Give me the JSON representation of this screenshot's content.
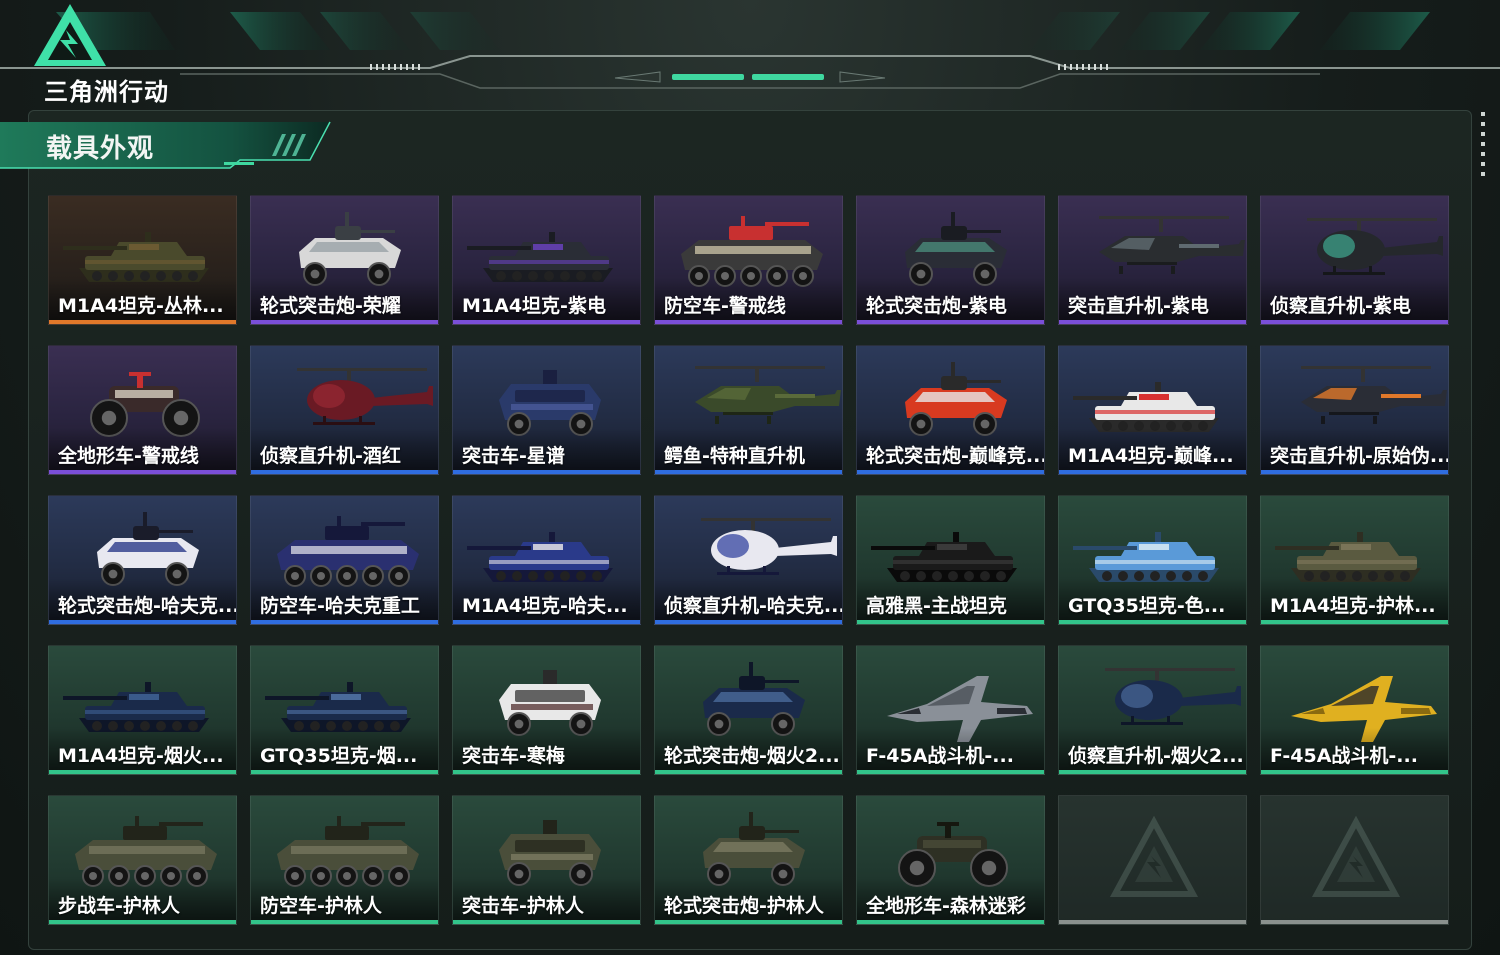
{
  "header": {
    "logo_text": "三角洲行动"
  },
  "section": {
    "title": "载具外观"
  },
  "colors": {
    "accent_green": "#32c48a",
    "rarity_orange": "#e0782a",
    "rarity_purple": "#7a4fd8",
    "rarity_blue": "#2f6de0",
    "rarity_green": "#32c48a",
    "empty": "#8a918e"
  },
  "items": [
    {
      "name": "M1A4坦克-丛林...",
      "rarity": "orange",
      "kind": "tank",
      "palette": [
        "#4a4a2c",
        "#6b5a32",
        "#2e2e1c"
      ]
    },
    {
      "name": "轮式突击炮-荣耀",
      "rarity": "purple",
      "kind": "armored-car",
      "palette": [
        "#d8d8d8",
        "#9aa3a8",
        "#3a3f44"
      ]
    },
    {
      "name": "M1A4坦克-紫电",
      "rarity": "purple",
      "kind": "tank",
      "palette": [
        "#2a2d36",
        "#5f3ea8",
        "#1a1c22"
      ]
    },
    {
      "name": "防空车-警戒线",
      "rarity": "purple",
      "kind": "apc",
      "palette": [
        "#3a3a3a",
        "#d8d0b0",
        "#c83030"
      ]
    },
    {
      "name": "轮式突击炮-紫电",
      "rarity": "purple",
      "kind": "armored-car",
      "palette": [
        "#2a2d36",
        "#4a8a7a",
        "#1a1c22"
      ]
    },
    {
      "name": "突击直升机-紫电",
      "rarity": "purple",
      "kind": "attack-heli",
      "palette": [
        "#2a2d30",
        "#5f6a70",
        "#1a1c1e"
      ]
    },
    {
      "name": "侦察直升机-紫电",
      "rarity": "purple",
      "kind": "scout-heli",
      "palette": [
        "#25282c",
        "#3fa890",
        "#151719"
      ]
    },
    {
      "name": "全地形车-警戒线",
      "rarity": "purple",
      "kind": "atv",
      "palette": [
        "#3a2a2a",
        "#d8d0c0",
        "#c83030"
      ]
    },
    {
      "name": "侦察直升机-酒红",
      "rarity": "blue",
      "kind": "scout-heli",
      "palette": [
        "#6a1a24",
        "#9a2a34",
        "#2a0e12"
      ]
    },
    {
      "name": "突击车-星谱",
      "rarity": "blue",
      "kind": "suv",
      "palette": [
        "#2a3a6a",
        "#4a5a9a",
        "#1a2040"
      ]
    },
    {
      "name": "鳄鱼-特种直升机",
      "rarity": "blue",
      "kind": "attack-heli",
      "palette": [
        "#3a4a2a",
        "#5a6a3a",
        "#1e2616"
      ]
    },
    {
      "name": "轮式突击炮-巅峰竞...",
      "rarity": "blue",
      "kind": "armored-car",
      "palette": [
        "#d83a20",
        "#e8e8e8",
        "#2a2a2a"
      ]
    },
    {
      "name": "M1A4坦克-巅峰...",
      "rarity": "blue",
      "kind": "tank",
      "palette": [
        "#e8e8e8",
        "#d83030",
        "#2a2a2a"
      ]
    },
    {
      "name": "突击直升机-原始伪...",
      "rarity": "blue",
      "kind": "attack-heli",
      "palette": [
        "#2a2d36",
        "#e0782a",
        "#15171c"
      ]
    },
    {
      "name": "轮式突击炮-哈夫克...",
      "rarity": "blue",
      "kind": "armored-car",
      "palette": [
        "#e8e8f0",
        "#2a3a8a",
        "#1a1c2a"
      ]
    },
    {
      "name": "防空车-哈夫克重工",
      "rarity": "blue",
      "kind": "apc",
      "palette": [
        "#2a3070",
        "#e8e8f0",
        "#15183a"
      ]
    },
    {
      "name": "M1A4坦克-哈夫...",
      "rarity": "blue",
      "kind": "tank",
      "palette": [
        "#2a3a8a",
        "#c8c8d8",
        "#15183a"
      ]
    },
    {
      "name": "侦察直升机-哈夫克...",
      "rarity": "blue",
      "kind": "scout-heli",
      "palette": [
        "#e8e8f0",
        "#2a3a9a",
        "#15183a"
      ]
    },
    {
      "name": "高雅黑-主战坦克",
      "rarity": "green",
      "kind": "tank",
      "palette": [
        "#1a1a1a",
        "#3a3a3a",
        "#0a0a0a"
      ]
    },
    {
      "name": "GTQ35坦克-色...",
      "rarity": "green",
      "kind": "tank",
      "palette": [
        "#5a9ad8",
        "#c8e0f0",
        "#2a4a6a"
      ]
    },
    {
      "name": "M1A4坦克-护林...",
      "rarity": "green",
      "kind": "tank",
      "palette": [
        "#5a5a40",
        "#7a7458",
        "#2e2e22"
      ]
    },
    {
      "name": "M1A4坦克-烟火...",
      "rarity": "green",
      "kind": "tank",
      "palette": [
        "#1a2a4a",
        "#3a5a8a",
        "#0e1628"
      ]
    },
    {
      "name": "GTQ35坦克-烟...",
      "rarity": "green",
      "kind": "tank",
      "palette": [
        "#1a2a4a",
        "#4a6a9a",
        "#0e1628"
      ]
    },
    {
      "name": "突击车-寒梅",
      "rarity": "green",
      "kind": "suv",
      "palette": [
        "#e8e8e8",
        "#5a3a3a",
        "#2a2a2a"
      ]
    },
    {
      "name": "轮式突击炮-烟火2...",
      "rarity": "green",
      "kind": "armored-car",
      "palette": [
        "#1a2a4a",
        "#4a6a9a",
        "#0e1628"
      ]
    },
    {
      "name": "F-45A战斗机-...",
      "rarity": "green",
      "kind": "jet",
      "palette": [
        "#8a9098",
        "#4a5058",
        "#2a2e34"
      ]
    },
    {
      "name": "侦察直升机-烟火2...",
      "rarity": "green",
      "kind": "scout-heli",
      "palette": [
        "#1a2a4a",
        "#4a6a9a",
        "#0e1628"
      ]
    },
    {
      "name": "F-45A战斗机-...",
      "rarity": "green",
      "kind": "jet",
      "palette": [
        "#e0b020",
        "#2a2a2a",
        "#8a6a10"
      ]
    },
    {
      "name": "步战车-护林人",
      "rarity": "green",
      "kind": "apc",
      "palette": [
        "#4a4e3a",
        "#7a7a62",
        "#22241a"
      ]
    },
    {
      "name": "防空车-护林人",
      "rarity": "green",
      "kind": "apc",
      "palette": [
        "#4a4e3a",
        "#7a7a62",
        "#22241a"
      ]
    },
    {
      "name": "突击车-护林人",
      "rarity": "green",
      "kind": "suv",
      "palette": [
        "#4a4e3a",
        "#7a7a62",
        "#22241a"
      ]
    },
    {
      "name": "轮式突击炮-护林人",
      "rarity": "green",
      "kind": "armored-car",
      "palette": [
        "#4a4e3a",
        "#7a7a62",
        "#22241a"
      ]
    },
    {
      "name": "全地形车-森林迷彩",
      "rarity": "green",
      "kind": "atv",
      "palette": [
        "#2e3024",
        "#4a4c38",
        "#16170f"
      ]
    },
    {
      "name": "",
      "rarity": "empty",
      "kind": "empty",
      "palette": []
    },
    {
      "name": "",
      "rarity": "empty",
      "kind": "empty",
      "palette": []
    }
  ]
}
